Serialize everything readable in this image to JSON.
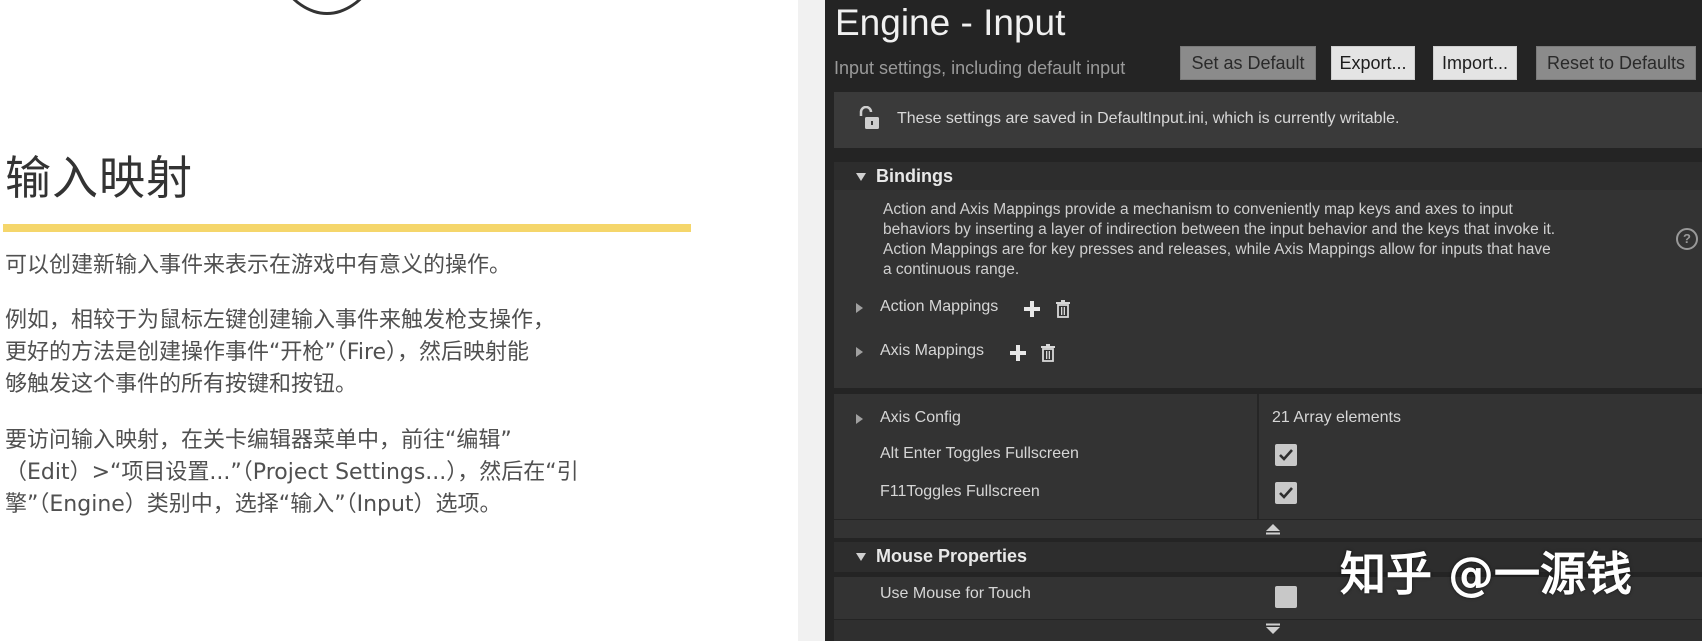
{
  "slide": {
    "title": "输入映射",
    "para1": "可以创建新输入事件来表示在游戏中有意义的操作。",
    "para2_line1": "例如，相较于为鼠标左键创建输入事件来触发枪支操作，",
    "para2_line2": "更好的方法是创建操作事件“开枪”（Fire），然后映射能",
    "para2_line3": "够触发这个事件的所有按键和按钮。",
    "para3_line1": "要访问输入映射，在关卡编辑器菜单中，前往“编辑”",
    "para3_line2": "（Edit）>“项目设置...”（Project Settings...），然后在“引",
    "para3_line3": "擎”（Engine）类别中，选择“输入”（Input）选项。",
    "accent_color": "#f5d66b"
  },
  "panel": {
    "title": "Engine - Input",
    "subtitle": "Input settings, including default input",
    "buttons": {
      "set_default": "Set as Default",
      "export": "Export...",
      "import": "Import...",
      "reset": "Reset to Defaults"
    },
    "notice": "These settings are saved in DefaultInput.ini, which is currently writable.",
    "bindings": {
      "header": "Bindings",
      "desc_line1": "Action and Axis Mappings provide a mechanism to conveniently map keys and axes to input",
      "desc_line2": "behaviors by inserting a layer of indirection between the input behavior and the keys that invoke it.",
      "desc_line3": "Action Mappings are for key presses and releases, while Axis Mappings allow for inputs that have",
      "desc_line4": "a continuous range.",
      "action_mappings": "Action Mappings",
      "axis_mappings": "Axis Mappings",
      "help_glyph": "?"
    },
    "config": {
      "axis_config": "Axis Config",
      "axis_config_value": "21 Array elements",
      "alt_enter": "Alt Enter Toggles Fullscreen",
      "alt_enter_checked": true,
      "f11": "F11Toggles Fullscreen",
      "f11_checked": true
    },
    "mouse": {
      "header": "Mouse Properties",
      "use_mouse_for_touch": "Use Mouse for Touch",
      "use_mouse_for_touch_checked": false
    }
  },
  "watermark": "知乎 @一源钱"
}
